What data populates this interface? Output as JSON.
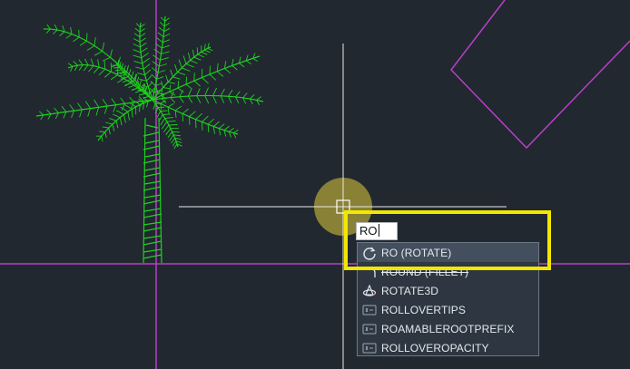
{
  "app": {
    "background_color": "#212830",
    "magenta_line_color": "#b83fc6",
    "tree_color": "#1fd11f",
    "highlight_color": "#f2e700"
  },
  "command_line": {
    "input_value": "RO"
  },
  "autocomplete": {
    "items": [
      {
        "label": "RO (ROTATE)",
        "icon": "rotate-icon"
      },
      {
        "label": "ROUND (FILLET)",
        "icon": "fillet-icon"
      },
      {
        "label": "ROTATE3D",
        "icon": "rotate3d-icon"
      },
      {
        "label": "ROLLOVERTIPS",
        "icon": "system-variable-icon"
      },
      {
        "label": "ROAMABLEROOTPREFIX",
        "icon": "system-variable-icon"
      },
      {
        "label": "ROLLOVEROPACITY",
        "icon": "system-variable-icon"
      }
    ]
  }
}
